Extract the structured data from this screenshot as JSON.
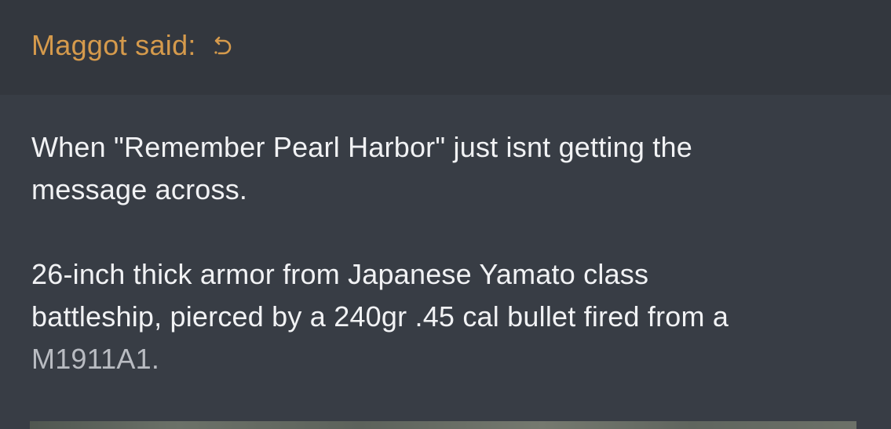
{
  "quote": {
    "author_label": "Maggot said:",
    "jump_icon": "reply-arrow-icon",
    "paragraph1_line1": "When \"Remember Pearl Harbor\" just isnt getting the",
    "paragraph1_line2": "message across.",
    "paragraph2_line1": "26-inch thick armor from Japanese Yamato class",
    "paragraph2_line2": "battleship, pierced by a 240gr .45 cal bullet fired from a",
    "paragraph2_line3": "M1911A1."
  },
  "colors": {
    "accent": "#d59a4c",
    "header_bg": "#33373e",
    "body_bg": "#383d45",
    "text": "#f1f2f4"
  }
}
